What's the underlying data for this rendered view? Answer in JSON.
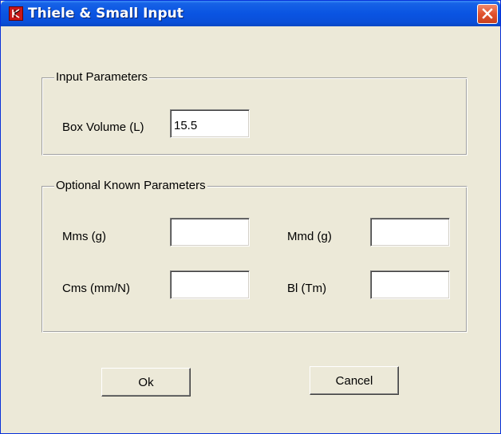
{
  "window": {
    "title": "Thiele & Small Input",
    "app_icon": "logo-icon",
    "close_icon": "close-icon"
  },
  "input_group": {
    "caption": "Input Parameters",
    "box_volume": {
      "label": "Box Volume (L)",
      "value": "15.5"
    }
  },
  "optional_group": {
    "caption": "Optional Known Parameters",
    "mms": {
      "label": "Mms (g)",
      "value": ""
    },
    "mmd": {
      "label": "Mmd (g)",
      "value": ""
    },
    "cms": {
      "label": "Cms (mm/N)",
      "value": ""
    },
    "bl": {
      "label": "Bl (Tm)",
      "value": ""
    }
  },
  "buttons": {
    "ok_label": "Ok",
    "cancel_label": "Cancel"
  },
  "colors": {
    "titlebar": "#0A54E2",
    "face": "#ECE9D8",
    "close": "#E0512C",
    "icon_red": "#C81818"
  }
}
